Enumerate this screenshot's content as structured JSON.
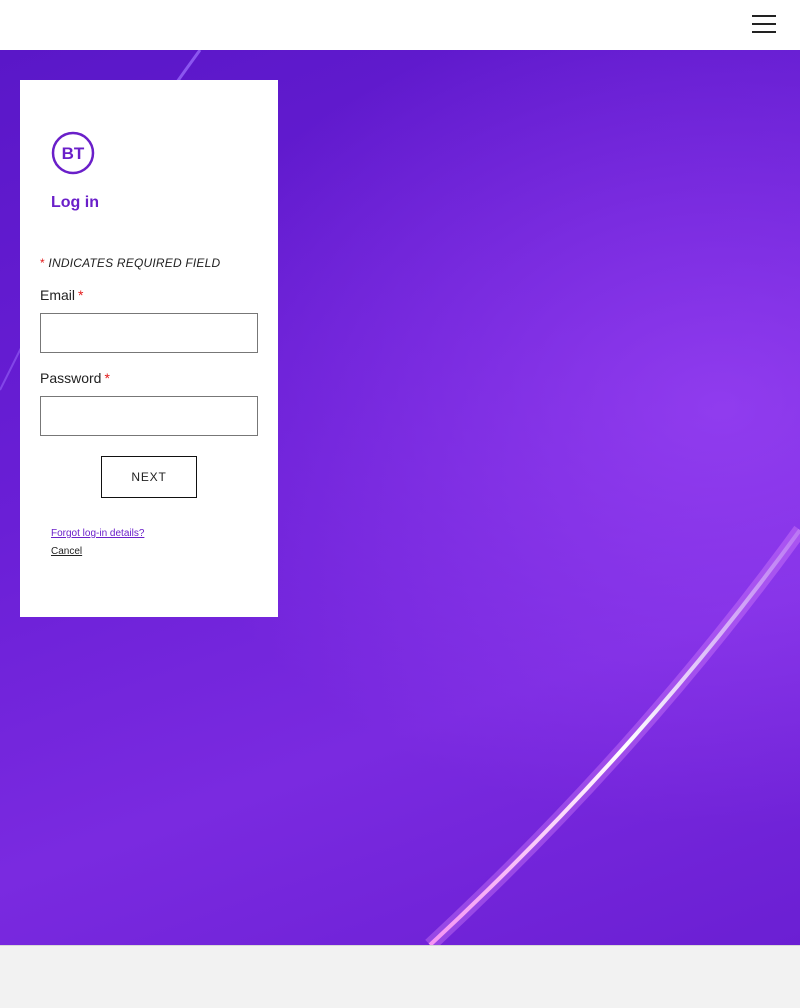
{
  "topbar": {
    "menu_icon": "hamburger-menu-icon"
  },
  "colors": {
    "brand_purple": "#6a1fc9",
    "hero_purple": "#5a17c8",
    "required_red": "#e31b1b"
  },
  "login": {
    "logo_text": "BT",
    "title": "Log in",
    "required_asterisk": "*",
    "required_note": "INDICATES REQUIRED FIELD",
    "email_label": "Email",
    "email_value": "",
    "password_label": "Password",
    "password_value": "",
    "next_label": "NEXT",
    "forgot_link": "Forgot log-in details?",
    "cancel_link": "Cancel"
  }
}
